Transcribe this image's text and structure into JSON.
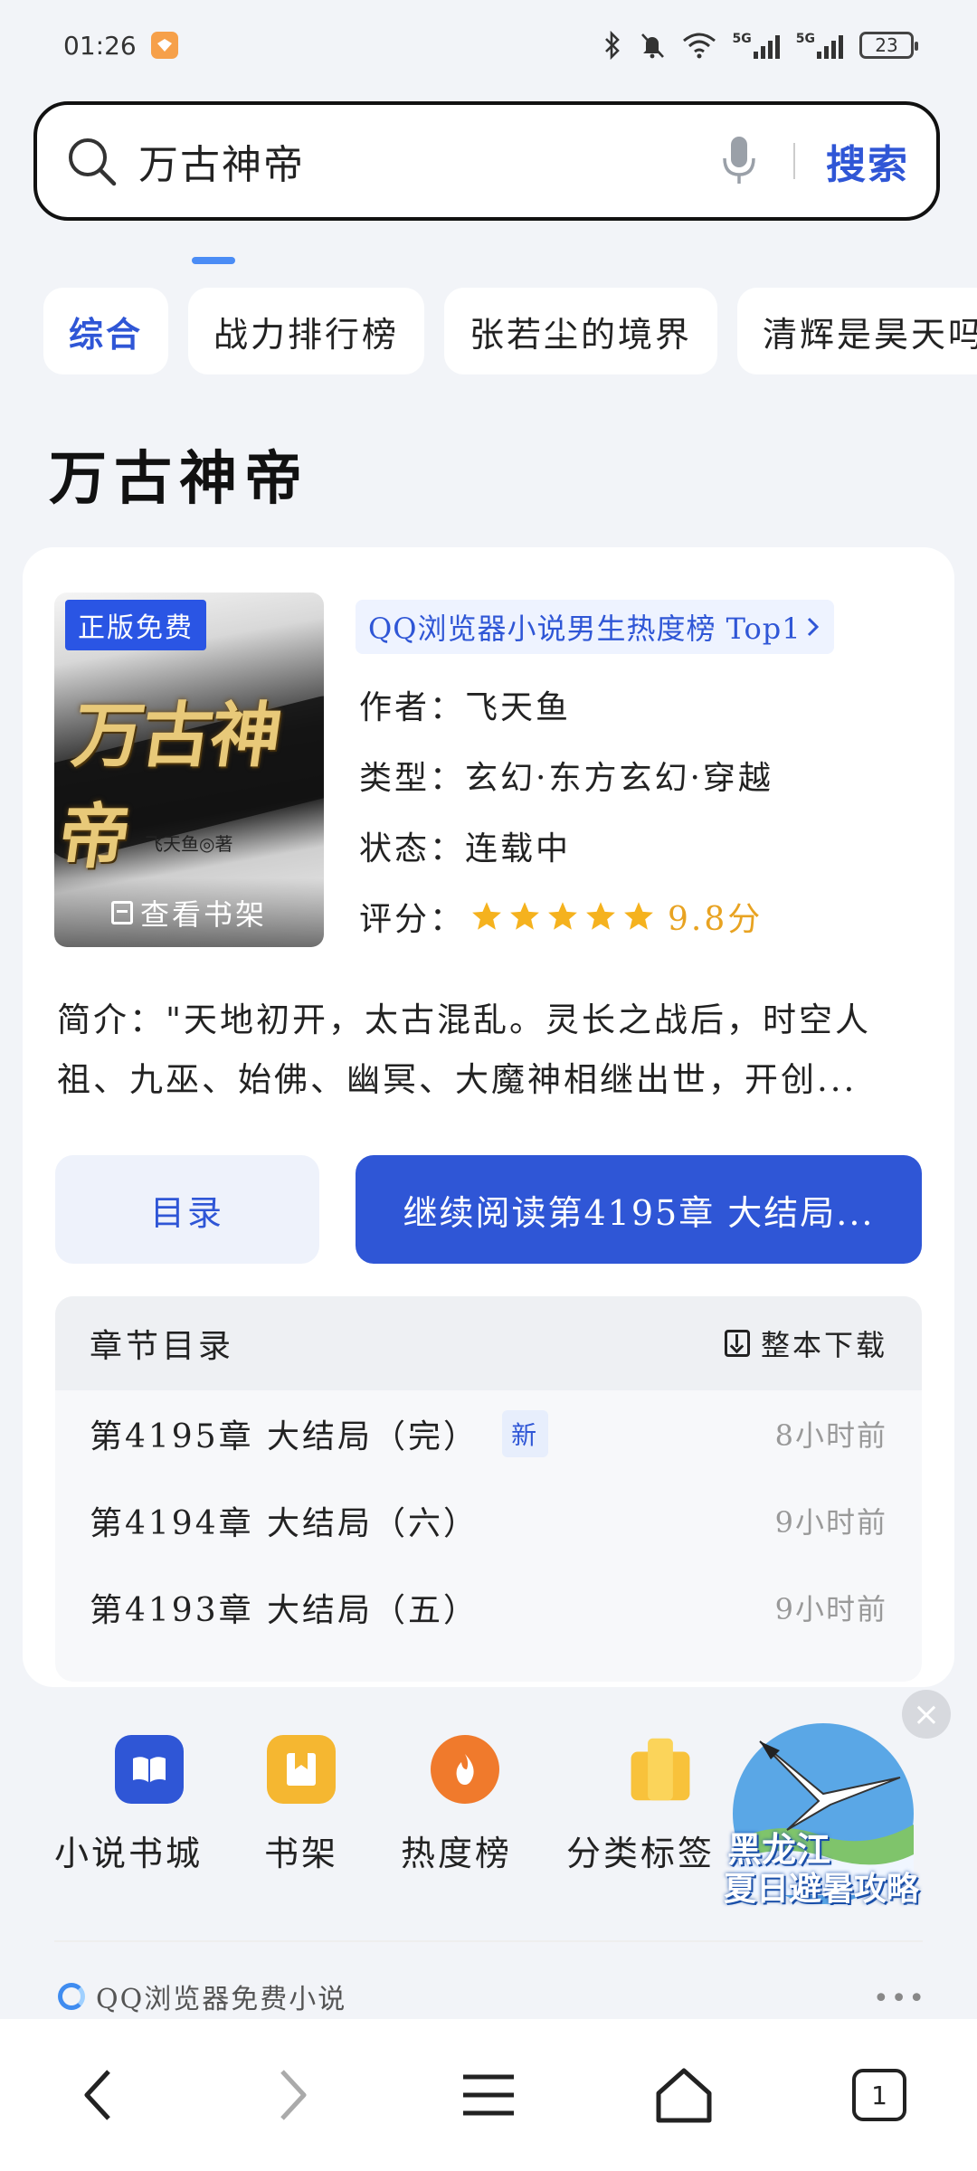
{
  "status_bar": {
    "time": "01:26",
    "net1": "5G",
    "net2": "5G",
    "battery": "23"
  },
  "search": {
    "query": "万古神帝",
    "button": "搜索"
  },
  "tabs": [
    {
      "label": "综合"
    },
    {
      "label": "战力排行榜"
    },
    {
      "label": "张若尘的境界"
    },
    {
      "label": "清辉是昊天吗"
    }
  ],
  "title": "万古神帝",
  "book": {
    "cover": {
      "badge": "正版免费",
      "art_title": "万古神帝",
      "art_author": "飞天鱼◎著",
      "shelf_label": "查看书架"
    },
    "rank": "QQ浏览器小说男生热度榜 Top1",
    "author_key": "作者：",
    "author": "飞天鱼",
    "genre_key": "类型：",
    "genre": "玄幻·东方玄幻·穿越",
    "status_key": "状态：",
    "status": "连载中",
    "rating_key": "评分：",
    "stars": 5,
    "score": "9.8分",
    "intro": "简介：\"天地初开，太古混乱。灵长之战后，时空人祖、九巫、始佛、幽冥、大魔神相继出世，开创..."
  },
  "actions": {
    "catalog": "目录",
    "continue": "继续阅读第4195章 大结局..."
  },
  "chapters": {
    "heading": "章节目录",
    "download": "整本下载",
    "items": [
      {
        "name": "第4195章 大结局（完）",
        "badge": "新",
        "time": "8小时前"
      },
      {
        "name": "第4194章 大结局（六）",
        "time": "9小时前"
      },
      {
        "name": "第4193章 大结局（五）",
        "time": "9小时前"
      }
    ]
  },
  "quick_links": [
    {
      "label": "小说书城",
      "icon": "book-open-icon",
      "color": "#2f56d6"
    },
    {
      "label": "书架",
      "icon": "bookmark-icon",
      "color": "#f5b731"
    },
    {
      "label": "热度榜",
      "icon": "flame-icon",
      "color": "#f07a2c"
    },
    {
      "label": "分类标签",
      "icon": "category-icon",
      "color": "#f8c23b"
    }
  ],
  "promo": {
    "line1": "黑龙江",
    "line2": "夏日避暑攻略"
  },
  "source": "QQ浏览器免费小说",
  "nav": {
    "tab_count": "1"
  },
  "colors": {
    "accent": "#2f56d6",
    "star": "#f5b21e",
    "score": "#e8a322"
  }
}
